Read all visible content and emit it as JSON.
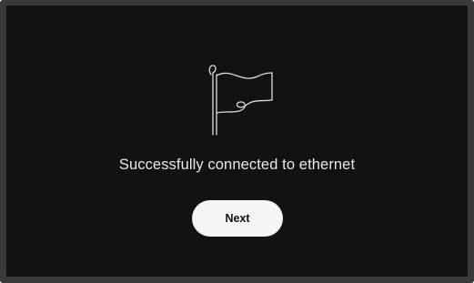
{
  "screen": {
    "icon": "flag-icon",
    "message": "Successfully connected to ethernet",
    "next_label": "Next"
  },
  "colors": {
    "bezel": "#3a3a3a",
    "background": "#121212",
    "text": "#e9e9e9",
    "button_bg": "#f5f5f5",
    "button_text": "#111111"
  }
}
